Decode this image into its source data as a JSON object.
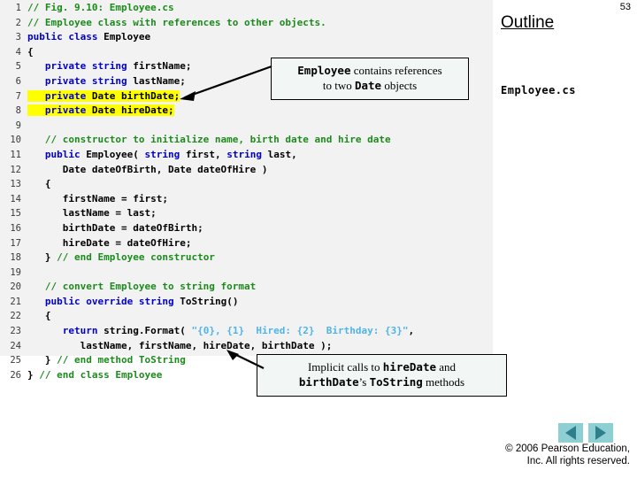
{
  "slide": {
    "number": "53",
    "outline_label": "Outline",
    "file_label": "Employee.cs"
  },
  "code": {
    "lines": [
      {
        "n": "1",
        "tokens": [
          {
            "t": "// Fig. 9.10: Employee.cs",
            "c": "cm",
            "indent": 0
          }
        ]
      },
      {
        "n": "2",
        "tokens": [
          {
            "t": "// Employee class with references to other objects.",
            "c": "cm",
            "indent": 0
          }
        ]
      },
      {
        "n": "3",
        "tokens": [
          {
            "t": "public",
            "c": "k",
            "indent": 0
          },
          {
            "t": " ",
            "c": "p"
          },
          {
            "t": "class",
            "c": "k"
          },
          {
            "t": " ",
            "c": "p"
          },
          {
            "t": "Employee",
            "c": "id"
          }
        ]
      },
      {
        "n": "4",
        "tokens": [
          {
            "t": "{",
            "c": "id",
            "indent": 0
          }
        ]
      },
      {
        "n": "5",
        "tokens": [
          {
            "t": "private",
            "c": "k",
            "indent": 3
          },
          {
            "t": " ",
            "c": "p"
          },
          {
            "t": "string",
            "c": "k"
          },
          {
            "t": " ",
            "c": "p"
          },
          {
            "t": "firstName;",
            "c": "id"
          }
        ]
      },
      {
        "n": "6",
        "tokens": [
          {
            "t": "private",
            "c": "k",
            "indent": 3
          },
          {
            "t": " ",
            "c": "p"
          },
          {
            "t": "string",
            "c": "k"
          },
          {
            "t": " ",
            "c": "p"
          },
          {
            "t": "lastName;",
            "c": "id"
          }
        ]
      },
      {
        "n": "7",
        "highlight": true,
        "tokens": [
          {
            "t": "private",
            "c": "k",
            "indent": 3
          },
          {
            "t": " ",
            "c": "p"
          },
          {
            "t": "Date",
            "c": "id"
          },
          {
            "t": " ",
            "c": "p"
          },
          {
            "t": "birthDate;",
            "c": "id"
          }
        ]
      },
      {
        "n": "8",
        "highlight": true,
        "tokens": [
          {
            "t": "private",
            "c": "k",
            "indent": 3
          },
          {
            "t": " ",
            "c": "p"
          },
          {
            "t": "Date",
            "c": "id"
          },
          {
            "t": " ",
            "c": "p"
          },
          {
            "t": "hireDate;",
            "c": "id"
          }
        ]
      },
      {
        "n": "9",
        "tokens": []
      },
      {
        "n": "10",
        "tokens": [
          {
            "t": "// constructor to initialize name, birth date and hire date",
            "c": "cm",
            "indent": 3
          }
        ]
      },
      {
        "n": "11",
        "tokens": [
          {
            "t": "public",
            "c": "k",
            "indent": 3
          },
          {
            "t": " ",
            "c": "p"
          },
          {
            "t": "Employee(",
            "c": "id"
          },
          {
            "t": " ",
            "c": "p"
          },
          {
            "t": "string",
            "c": "k"
          },
          {
            "t": " ",
            "c": "p"
          },
          {
            "t": "first,",
            "c": "id"
          },
          {
            "t": " ",
            "c": "p"
          },
          {
            "t": "string",
            "c": "k"
          },
          {
            "t": " ",
            "c": "p"
          },
          {
            "t": "last,",
            "c": "id"
          }
        ]
      },
      {
        "n": "12",
        "tokens": [
          {
            "t": "Date dateOfBirth, Date dateOfHire )",
            "c": "id",
            "indent": 6
          }
        ]
      },
      {
        "n": "13",
        "tokens": [
          {
            "t": "{",
            "c": "id",
            "indent": 3
          }
        ]
      },
      {
        "n": "14",
        "tokens": [
          {
            "t": "firstName = first;",
            "c": "id",
            "indent": 6
          }
        ]
      },
      {
        "n": "15",
        "tokens": [
          {
            "t": "lastName = last;",
            "c": "id",
            "indent": 6
          }
        ]
      },
      {
        "n": "16",
        "tokens": [
          {
            "t": "birthDate = dateOfBirth;",
            "c": "id",
            "indent": 6
          }
        ]
      },
      {
        "n": "17",
        "tokens": [
          {
            "t": "hireDate = dateOfHire;",
            "c": "id",
            "indent": 6
          }
        ]
      },
      {
        "n": "18",
        "tokens": [
          {
            "t": "}",
            "c": "id",
            "indent": 3
          },
          {
            "t": " ",
            "c": "p"
          },
          {
            "t": "// end Employee constructor",
            "c": "cm"
          }
        ]
      },
      {
        "n": "19",
        "tokens": []
      },
      {
        "n": "20",
        "tokens": [
          {
            "t": "// convert Employee to string format",
            "c": "cm",
            "indent": 3
          }
        ]
      },
      {
        "n": "21",
        "tokens": [
          {
            "t": "public",
            "c": "k",
            "indent": 3
          },
          {
            "t": " ",
            "c": "p"
          },
          {
            "t": "override",
            "c": "k"
          },
          {
            "t": " ",
            "c": "p"
          },
          {
            "t": "string",
            "c": "k"
          },
          {
            "t": " ",
            "c": "p"
          },
          {
            "t": "ToString()",
            "c": "id"
          }
        ]
      },
      {
        "n": "22",
        "tokens": [
          {
            "t": "{",
            "c": "id",
            "indent": 3
          }
        ]
      },
      {
        "n": "23",
        "tokens": [
          {
            "t": "return",
            "c": "k",
            "indent": 6
          },
          {
            "t": " ",
            "c": "p"
          },
          {
            "t": "string.Format(",
            "c": "id"
          },
          {
            "t": " ",
            "c": "p"
          },
          {
            "t": "\"{0}, {1}  Hired: {2}  Birthday: {3}\"",
            "c": "st"
          },
          {
            "t": ",",
            "c": "id"
          }
        ]
      },
      {
        "n": "24",
        "tokens": [
          {
            "t": "lastName, firstName, hireDate, birthDate );",
            "c": "id",
            "indent": 9
          }
        ]
      },
      {
        "n": "25",
        "tokens": [
          {
            "t": "}",
            "c": "id",
            "indent": 3
          },
          {
            "t": " ",
            "c": "p"
          },
          {
            "t": "// end method ToString",
            "c": "cm"
          }
        ]
      },
      {
        "n": "26",
        "tokens": [
          {
            "t": "}",
            "c": "id",
            "indent": 0
          },
          {
            "t": " ",
            "c": "p"
          },
          {
            "t": "// end class Employee",
            "c": "cm"
          }
        ]
      }
    ]
  },
  "callouts": {
    "top": {
      "line1_a": "Employee",
      "line1_b": " contains references",
      "line2_a": "to two ",
      "line2_b": "Date",
      "line2_c": " objects"
    },
    "bottom": {
      "line1_a": "Implicit calls to ",
      "line1_b": "hireDate",
      "line1_c": " and",
      "line2_a": "birthDate",
      "line2_b": "’s ",
      "line2_c": "ToString",
      "line2_d": " methods"
    }
  },
  "nav": {
    "prev_label": "previous-slide",
    "next_label": "next-slide"
  },
  "footer": {
    "line1": "© 2006 Pearson Education,",
    "line2": "Inc.  All rights reserved."
  },
  "colors": {
    "panel_bg": "#f2f2f2",
    "keyword": "#0000c8",
    "comment": "#1b8b1b",
    "string": "#4fb4e8",
    "highlight": "#ffff00",
    "callout_bg": "#f2f7f5",
    "nav_bg": "#8ecfd4",
    "nav_arrow": "#2e7f8c"
  }
}
